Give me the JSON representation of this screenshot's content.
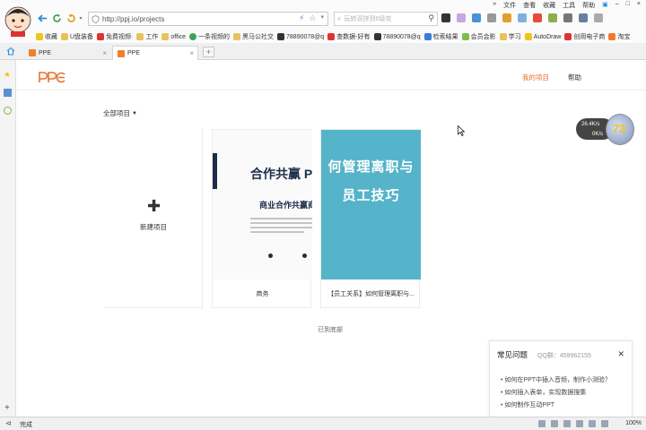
{
  "browser": {
    "url": "http://ppj.io/projects",
    "search_placeholder": "玩转双拼到6级攻",
    "menus": [
      "文件",
      "查看",
      "收藏",
      "工具",
      "帮助"
    ],
    "bookmarks": [
      "收藏",
      "U盘装备",
      "免费视频·",
      "工作",
      "office",
      "一条视频的",
      "黑马公社交",
      "78890078@q",
      "查数据-好有",
      "78890078@q",
      "检索结果",
      "会员会影",
      "学习",
      "AutoDraw",
      "创用电子商",
      "淘宝"
    ],
    "tabs": [
      {
        "label": "PPE",
        "active": false
      },
      {
        "label": "PPE",
        "active": true
      }
    ],
    "status_text": "完成",
    "zoom": "100%"
  },
  "header": {
    "nav_my_projects": "我的项目",
    "nav_help": "帮助"
  },
  "filter": {
    "label": "全部项目"
  },
  "new_project": {
    "label": "新建项目"
  },
  "projects": [
    {
      "title": "商务",
      "thumb_title": "合作共赢 P",
      "thumb_subtitle": "商业合作共赢商"
    },
    {
      "title": "【员工关系】如何管理离职与...",
      "thumb_line1": "何管理离职与",
      "thumb_line2": "员工技巧"
    }
  ],
  "bottom_note": "已到底部",
  "faq": {
    "title": "常见问题",
    "qq": "QQ群：459962155",
    "items": [
      "如何在PPT中插入音频，制作小测验？",
      "如何插入表单，实现数据搜集",
      "如何制作互动PPT"
    ]
  },
  "speed_widget": {
    "upload": "26.4K/s",
    "download": "0K/s",
    "value": "73"
  },
  "colors": {
    "accent": "#e8712f",
    "thumb2_bg": "#55b4c9",
    "navy": "#1d2d4a"
  }
}
